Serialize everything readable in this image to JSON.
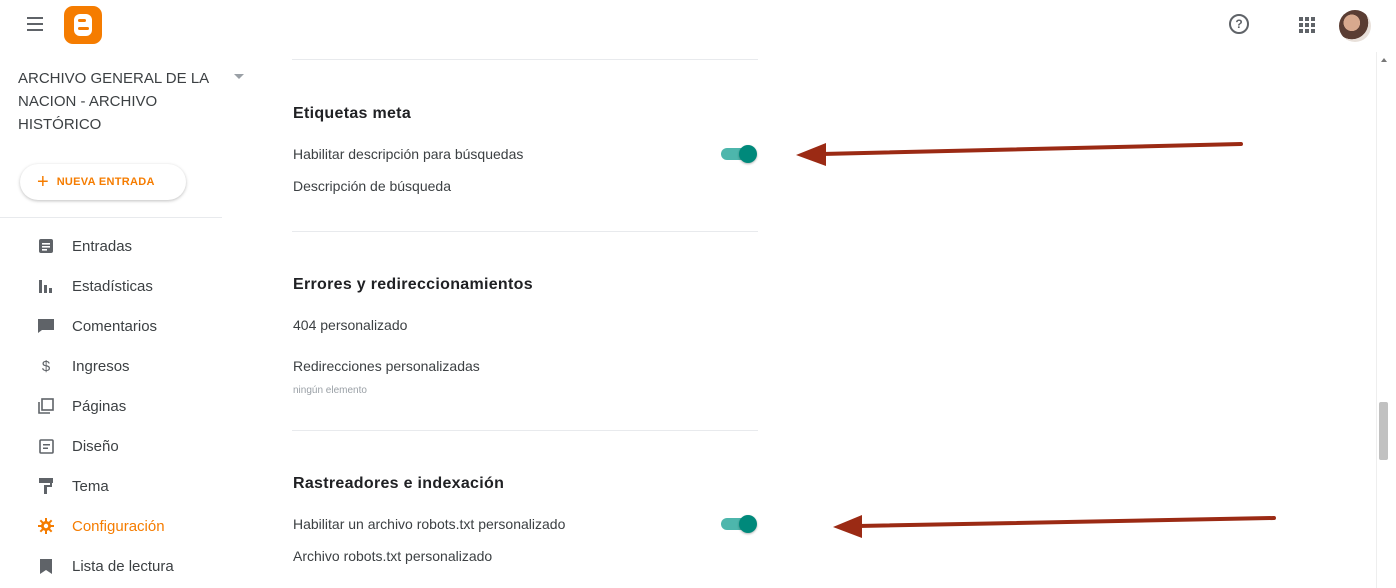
{
  "app": {
    "logo_name": "blogger-logo",
    "accent_color": "#f57c00",
    "toggle_color": "#00897b",
    "annotation_arrow_color": "#9b2a14"
  },
  "header": {
    "help_icon": "help-circle-icon",
    "apps_icon": "apps-grid-icon",
    "help_glyph": "?"
  },
  "sidebar": {
    "blog_name": "ARCHIVO GENERAL DE LA NACION - ARCHIVO HISTÓRICO",
    "new_post_plus": "+",
    "new_post_label": "NUEVA ENTRADA",
    "items": [
      {
        "label": "Entradas",
        "icon": "posts-icon"
      },
      {
        "label": "Estadísticas",
        "icon": "stats-icon"
      },
      {
        "label": "Comentarios",
        "icon": "comments-icon"
      },
      {
        "label": "Ingresos",
        "icon": "earnings-icon",
        "glyph": "$"
      },
      {
        "label": "Páginas",
        "icon": "pages-icon"
      },
      {
        "label": "Diseño",
        "icon": "layout-icon"
      },
      {
        "label": "Tema",
        "icon": "theme-icon"
      },
      {
        "label": "Configuración",
        "icon": "settings-icon",
        "active": true
      },
      {
        "label": "Lista de lectura",
        "icon": "reading-list-icon"
      }
    ]
  },
  "main": {
    "meta_tags": {
      "title": "Etiquetas meta",
      "enable_search_description": "Habilitar descripción para búsquedas",
      "enable_search_description_on": true,
      "search_description": "Descripción de búsqueda"
    },
    "errors": {
      "title": "Errores y redireccionamientos",
      "custom_404": "404 personalizado",
      "custom_redirects": "Redirecciones personalizadas",
      "custom_redirects_value": "ningún elemento"
    },
    "crawlers": {
      "title": "Rastreadores e indexación",
      "enable_robots": "Habilitar un archivo robots.txt personalizado",
      "enable_robots_on": true,
      "robots_file": "Archivo robots.txt personalizado"
    }
  }
}
